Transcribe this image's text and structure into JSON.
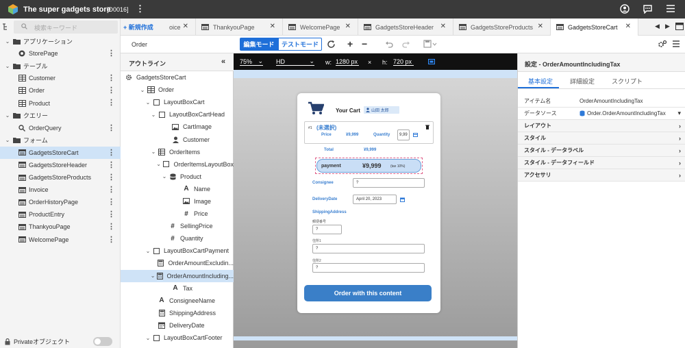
{
  "app": {
    "title": "The super gadgets store",
    "code": "[D0016]"
  },
  "left": {
    "search_placeholder": "検索キーワード",
    "tree": [
      {
        "label": "アプリケーション",
        "type": "folder"
      },
      {
        "label": "StorePage",
        "type": "page"
      },
      {
        "label": "テーブル",
        "type": "folder"
      },
      {
        "label": "Customer",
        "type": "table"
      },
      {
        "label": "Order",
        "type": "table"
      },
      {
        "label": "Product",
        "type": "table"
      },
      {
        "label": "クエリー",
        "type": "folder"
      },
      {
        "label": "OrderQuery",
        "type": "query"
      },
      {
        "label": "フォーム",
        "type": "folder"
      },
      {
        "label": "GadgetsStoreCart",
        "type": "form"
      },
      {
        "label": "GadgetsStoreHeader",
        "type": "form"
      },
      {
        "label": "GadgetsStoreProducts",
        "type": "form"
      },
      {
        "label": "Invoice",
        "type": "form"
      },
      {
        "label": "OrderHistoryPage",
        "type": "form"
      },
      {
        "label": "ProductEntry",
        "type": "form"
      },
      {
        "label": "ThankyouPage",
        "type": "form"
      },
      {
        "label": "WelcomePage",
        "type": "form"
      }
    ],
    "private_label": "Privateオブジェクト"
  },
  "tabs": {
    "new_label": "+ 新規作成",
    "items": [
      {
        "label": "oice"
      },
      {
        "label": "ThankyouPage"
      },
      {
        "label": "WelcomePage"
      },
      {
        "label": "GadgetsStoreHeader"
      },
      {
        "label": "GadgetsStoreProducts"
      },
      {
        "label": "GadgetsStoreCart"
      }
    ]
  },
  "toolbar": {
    "crumb": "Order",
    "edit_mode": "編集モード",
    "test_mode": "テストモード"
  },
  "outline": {
    "title": "アウトライン",
    "rows": [
      {
        "label": "GadgetsStoreCart",
        "icon": "gear"
      },
      {
        "label": "Order",
        "icon": "table"
      },
      {
        "label": "LayoutBoxCart",
        "icon": "box"
      },
      {
        "label": "LayoutBoxCartHead",
        "icon": "box"
      },
      {
        "label": "CartImage",
        "icon": "image"
      },
      {
        "label": "Customer",
        "icon": "person"
      },
      {
        "label": "OrderItems",
        "icon": "grid"
      },
      {
        "label": "OrderItemsLayoutBox",
        "icon": "box"
      },
      {
        "label": "Product",
        "icon": "db"
      },
      {
        "label": "Name",
        "icon": "A"
      },
      {
        "label": "Image",
        "icon": "image"
      },
      {
        "label": "Price",
        "icon": "#"
      },
      {
        "label": "SellingPrice",
        "icon": "#"
      },
      {
        "label": "Quantity",
        "icon": "#"
      },
      {
        "label": "LayoutBoxCartPayment",
        "icon": "box"
      },
      {
        "label": "OrderAmountExcludin...",
        "icon": "calc"
      },
      {
        "label": "OrderAmountIncluding...",
        "icon": "calc"
      },
      {
        "label": "Tax",
        "icon": "A"
      },
      {
        "label": "ConsigneeName",
        "icon": "A"
      },
      {
        "label": "ShippingAddress",
        "icon": "calc"
      },
      {
        "label": "DeliveryDate",
        "icon": "cal"
      },
      {
        "label": "LayoutBoxCartFooter",
        "icon": "box"
      }
    ]
  },
  "canvas": {
    "zoom": "75%",
    "res": "HD",
    "w_label": "w:",
    "w": "1280 px",
    "x": "×",
    "h_label": "h:",
    "h": "720 px"
  },
  "cart": {
    "title": "Your Cart",
    "user": "山田 太郎",
    "item_no": "#1",
    "unselected": "(未選択)",
    "price_label": "Price",
    "price": "¥9,999",
    "qty_label": "Quantity",
    "qty": "9,99",
    "total_label": "Total",
    "total": "¥9,999",
    "payment_label": "payment",
    "payment": "¥9,999",
    "tax_note": "(tax 10%)",
    "consignee_label": "Consignee",
    "consignee": "?",
    "delivery_label": "DeliveryDate",
    "delivery": "April 20, 2023",
    "shipping_label": "ShippingAddress",
    "zip_label": "郵便番号",
    "zip": "?",
    "addr1_label": "住所1",
    "addr1": "?",
    "addr2_label": "住所2",
    "addr2": "?",
    "order_button": "Order with this content"
  },
  "right": {
    "title": "設定 - OrderAmountIncludingTax",
    "tabs": [
      "基本設定",
      "詳細設定",
      "スクリプト"
    ],
    "props": [
      {
        "k": "アイテム名",
        "v": "OrderAmountIncludingTax"
      },
      {
        "k": "データソース",
        "v": "Order.OrderAmountIncludingTax"
      }
    ],
    "sections": [
      "レイアウト",
      "スタイル",
      "スタイル - データラベル",
      "スタイル - データフィールド",
      "アクセサリ"
    ]
  },
  "colors": {
    "accent": "#1e6fd9",
    "selection": "#cfe3f7",
    "topbar": "#3a3a3a",
    "order_button": "#3a7fc8"
  }
}
